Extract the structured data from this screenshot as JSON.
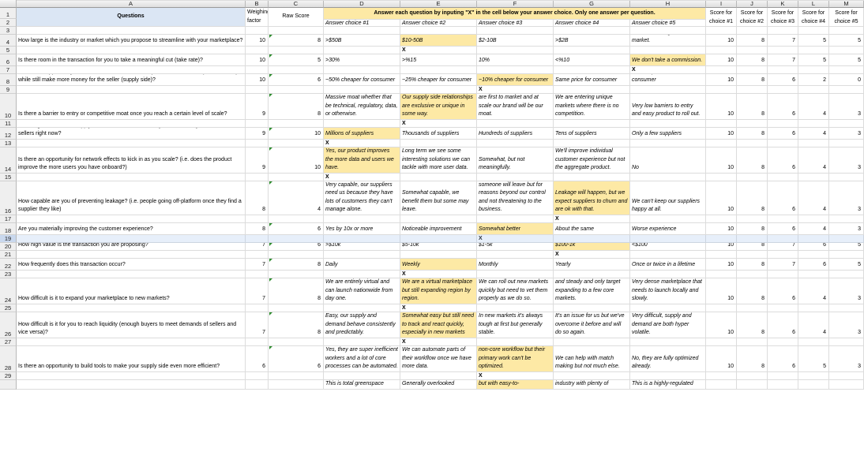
{
  "columns": [
    "A",
    "B",
    "C",
    "D",
    "E",
    "F",
    "G",
    "H",
    "I",
    "J",
    "K",
    "L",
    "M"
  ],
  "header": {
    "questions_label": "Questions",
    "weighing_label": "Weighing factor (1-10)",
    "raw_score_label": "Raw Score",
    "instruction": "Answer each question by inputing \"X\" in the cell below your answer choice. Only one answer per question.",
    "answer_choice_labels": [
      "Answer choice #1",
      "Answer choice #2",
      "Answer choice #3",
      "Answer choice #4",
      "Answer choice #5"
    ],
    "score_labels": [
      "Score for choice #1",
      "Score for choice #2",
      "Score for choice #3",
      "Score for choice #4",
      "Score for choice #5"
    ]
  },
  "row_numbers": [
    "1",
    "2",
    "3",
    "4",
    "5",
    "6",
    "7",
    "8",
    "9",
    "10",
    "11",
    "12",
    "13",
    "14",
    "15",
    "16",
    "17",
    "18",
    "19",
    "20",
    "21",
    "22",
    "23",
    "24",
    "25",
    "26",
    "27",
    "28",
    "29",
    ""
  ],
  "selected_row": "19",
  "questions": [
    {
      "q": "How large is the industry or market which you propose to streamline with your marketplace?",
      "w": "10",
      "raw": "8",
      "choices": [
        ">$50B",
        "$10-50B",
        "$2-10B",
        ">$2B",
        "We are creating a new market."
      ],
      "sel": 1,
      "mark": "X",
      "scores": [
        "10",
        "8",
        "7",
        "5",
        "5"
      ]
    },
    {
      "q": "Is there room in the transaction for you to take a meaningful cut (take rate)?",
      "w": "10",
      "raw": "5",
      "choices": [
        ">30%",
        ">%15",
        "10%",
        "<%10",
        "We don't take a commission."
      ],
      "sel": 4,
      "mark": "X",
      "scores": [
        "10",
        "8",
        "7",
        "5",
        "5"
      ]
    },
    {
      "q": "Is there an opportunity to make the service much cheaper for the customer (demand side) while still make more money for the seller (supply side)?",
      "w": "10",
      "raw": "6",
      "choices": [
        "~50% cheaper for consumer",
        "~25% cheaper for consumer",
        "~10% cheaper for consumer",
        "Same price for consumer",
        "More expensive for consumer"
      ],
      "sel": 2,
      "mark": "X",
      "scores": [
        "10",
        "8",
        "6",
        "2",
        "0"
      ]
    },
    {
      "q": "Is there a barrier to entry or competitive moat once you reach a certain level of scale?",
      "w": "9",
      "raw": "8",
      "choices": [
        "Massive moat whether that be technical, regulatory, data, or otherwise.",
        "Our supply side relationships are exclusive or unique in some way.",
        "Regional moat because we are first to market and at scale our brand will be our moat.",
        "We are entering unique markets where there is no competition.",
        "Very low barriers to entry and easy product to roll out."
      ],
      "sel": 1,
      "mark": "X",
      "scores": [
        "10",
        "8",
        "6",
        "4",
        "3"
      ]
    },
    {
      "q": "How fragmented is the supply side of the market? Is it very difficult for buyers to access sellers right now?",
      "w": "9",
      "raw": "10",
      "choices": [
        "Millions of suppliers",
        "Thousands of suppliers",
        "Hundreds of suppliers",
        "Tens of suppliers",
        "Only a few suppliers"
      ],
      "sel": 0,
      "mark": "X",
      "scores": [
        "10",
        "8",
        "6",
        "4",
        "3"
      ]
    },
    {
      "q": "Is there an opportunity for network effects to kick in as you scale? (i.e. does the product improve the more users you have onboard?)",
      "w": "9",
      "raw": "10",
      "choices": [
        "Yes, our product improves the more data and users we have.",
        "Long term we see some interesting solutions we can tackle with more user data.",
        "Somewhat, but not meaningfully.",
        "We'll improve individual customer experience but not the aggregate product.",
        "No"
      ],
      "sel": 0,
      "mark": "X",
      "scores": [
        "10",
        "8",
        "6",
        "4",
        "3"
      ]
    },
    {
      "q": "How capable are you of preventing leakage? (i.e. people going off-platform once they find a supplier they like)",
      "w": "8",
      "raw": "4",
      "choices": [
        "Very capable, our suppliers need us because they have lots of customers they can't manage alone.",
        "Somewhat capable, we benefit them but some may leave.",
        "Every now and then someone will leave but for reasons beyond our control and not threatening to the business.",
        "Leakage will happen, but we expect suppliers to churn and are ok with that.",
        "We can't keep our suppliers happy at all."
      ],
      "sel": 3,
      "mark": "X",
      "scores": [
        "10",
        "8",
        "6",
        "4",
        "3"
      ]
    },
    {
      "q": "Are you materially improving the customer experience?",
      "w": "8",
      "raw": "6",
      "choices": [
        "Yes by 10x or more",
        "Noticeable improvement",
        "Somewhat better",
        "About the same",
        "Worse experience"
      ],
      "sel": 2,
      "mark": "X",
      "scores": [
        "10",
        "8",
        "6",
        "4",
        "3"
      ]
    },
    {
      "q": "How high value is the transaction you are proposing?",
      "w": "7",
      "raw": "6",
      "choices": [
        ">$10k",
        "$5-10k",
        "$1-5k",
        "$100-1k",
        "<$100"
      ],
      "sel": 3,
      "mark": "X",
      "scores": [
        "10",
        "8",
        "7",
        "6",
        "5"
      ]
    },
    {
      "q": "How frequently does this transaction occur?",
      "w": "7",
      "raw": "8",
      "choices": [
        "Daily",
        "Weekly",
        "Monthly",
        "Yearly",
        "Once or twice in a lifetime"
      ],
      "sel": 1,
      "mark": "X",
      "scores": [
        "10",
        "8",
        "7",
        "6",
        "5"
      ]
    },
    {
      "q": "How difficult is it to expand your marketplace to new markets?",
      "w": "7",
      "raw": "8",
      "choices": [
        "We are entirely virtual and can launch nationwide from day one.",
        "We are a virtual marketplace but still expanding region by region.",
        "We can roll out new markets quickly but need to vet them properly as we do so.",
        "Our approach will be slow and steady and only target expanding to a few core markets.",
        "Very dense marketplace that needs to launch locally and slowly."
      ],
      "sel": 1,
      "mark": "X",
      "scores": [
        "10",
        "8",
        "6",
        "4",
        "3"
      ]
    },
    {
      "q": "How difficult is it for you to reach liquidity (enough buyers to meet demands of sellers and vice versa)?",
      "w": "7",
      "raw": "8",
      "choices": [
        "Easy, our supply and demand behave consistently and predictably.",
        "Somewhat easy but still need to track and react quickly, especially in new markets",
        "In new markets it's always tough at first but generally stable.",
        "It's an issue for us but we've overcome it before and will do so again.",
        "Very difficult, supply and demand are both hyper volatile."
      ],
      "sel": 1,
      "mark": "X",
      "scores": [
        "10",
        "8",
        "6",
        "4",
        "3"
      ]
    },
    {
      "q": "Is there an opportunity to build tools to make your supply side even more efficient?",
      "w": "6",
      "raw": "6",
      "choices": [
        "Yes, they are super inefficient workers and a lot of core processes can be automated.",
        "We can automate parts of their workflow once we have more data.",
        "We can build tools for their non-core workflow but their primary work can't be optimized.",
        "We can help with match making but not much else.",
        "No, they are fully optimized already."
      ],
      "sel": 2,
      "mark": "X",
      "scores": [
        "10",
        "8",
        "6",
        "5",
        "3"
      ]
    },
    {
      "q": "",
      "w": "",
      "raw": "",
      "choices": [
        "This is total greenspace",
        "Generally overlooked",
        "Somewhat regulated industry but with easy-to-",
        "Moderately regulated industry with plenty of",
        "This is a highly-regulated"
      ],
      "sel": 2,
      "mark": "",
      "scores": [
        "",
        "",
        "",
        "",
        ""
      ]
    }
  ]
}
